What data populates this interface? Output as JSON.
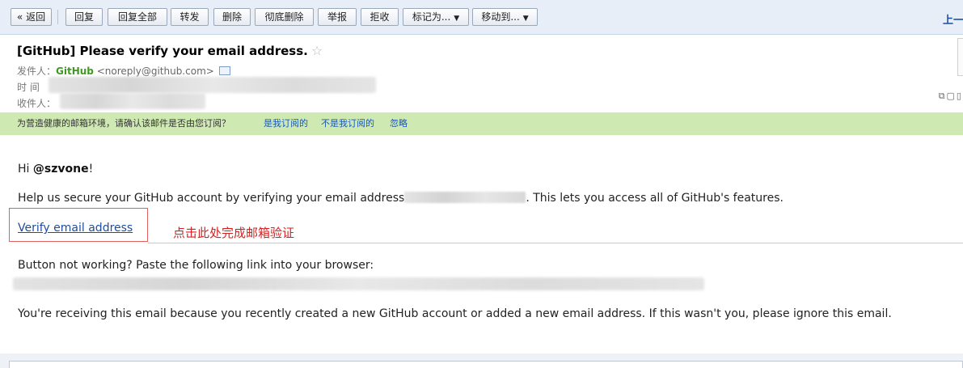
{
  "toolbar": {
    "back_label": "« 返回",
    "reply_label": "回复",
    "reply_all_label": "回复全部",
    "forward_label": "转发",
    "delete_label": "删除",
    "delete_permanently_label": "彻底删除",
    "report_label": "举报",
    "reject_label": "拒收",
    "mark_as_label": "标记为...",
    "move_to_label": "移动到...",
    "prev_email_label": "上一封"
  },
  "email": {
    "subject": "[GitHub] Please verify your email address.",
    "from_label": "发件人：",
    "from_name": "GitHub",
    "from_address": "<noreply@github.com>",
    "time_label": "时  间",
    "to_label": "收件人："
  },
  "notice": {
    "question": "为营造健康的邮箱环境，请确认该邮件是否由您订阅？",
    "yes_link": "是我订阅的",
    "no_link": "不是我订阅的",
    "ignore_link": "忽略"
  },
  "body": {
    "greeting_prefix": "Hi ",
    "username": "@szvone",
    "greeting_suffix": "!",
    "help_prefix": "Help us secure your GitHub account by verifying your email address",
    "help_suffix": ". This lets you access all of GitHub's features.",
    "verify_link": "Verify email address",
    "annotation": "点击此处完成邮箱验证",
    "button_hint": "Button not working? Paste the following link into your browser:",
    "footer": "You're receiving this email because you recently created a new GitHub account or added a new email address. If this wasn't you, please ignore this email."
  },
  "colors": {
    "toolbar_bg": "#e8eef7",
    "notice_bg": "#cfe9b3",
    "sender_green": "#3d9a1f",
    "link_blue": "#1d4e9a",
    "annotation_red": "#d92020"
  },
  "icons": {
    "star": "star-icon",
    "contact_card": "contact-card-icon",
    "window_controls": "window-controls-icon"
  }
}
